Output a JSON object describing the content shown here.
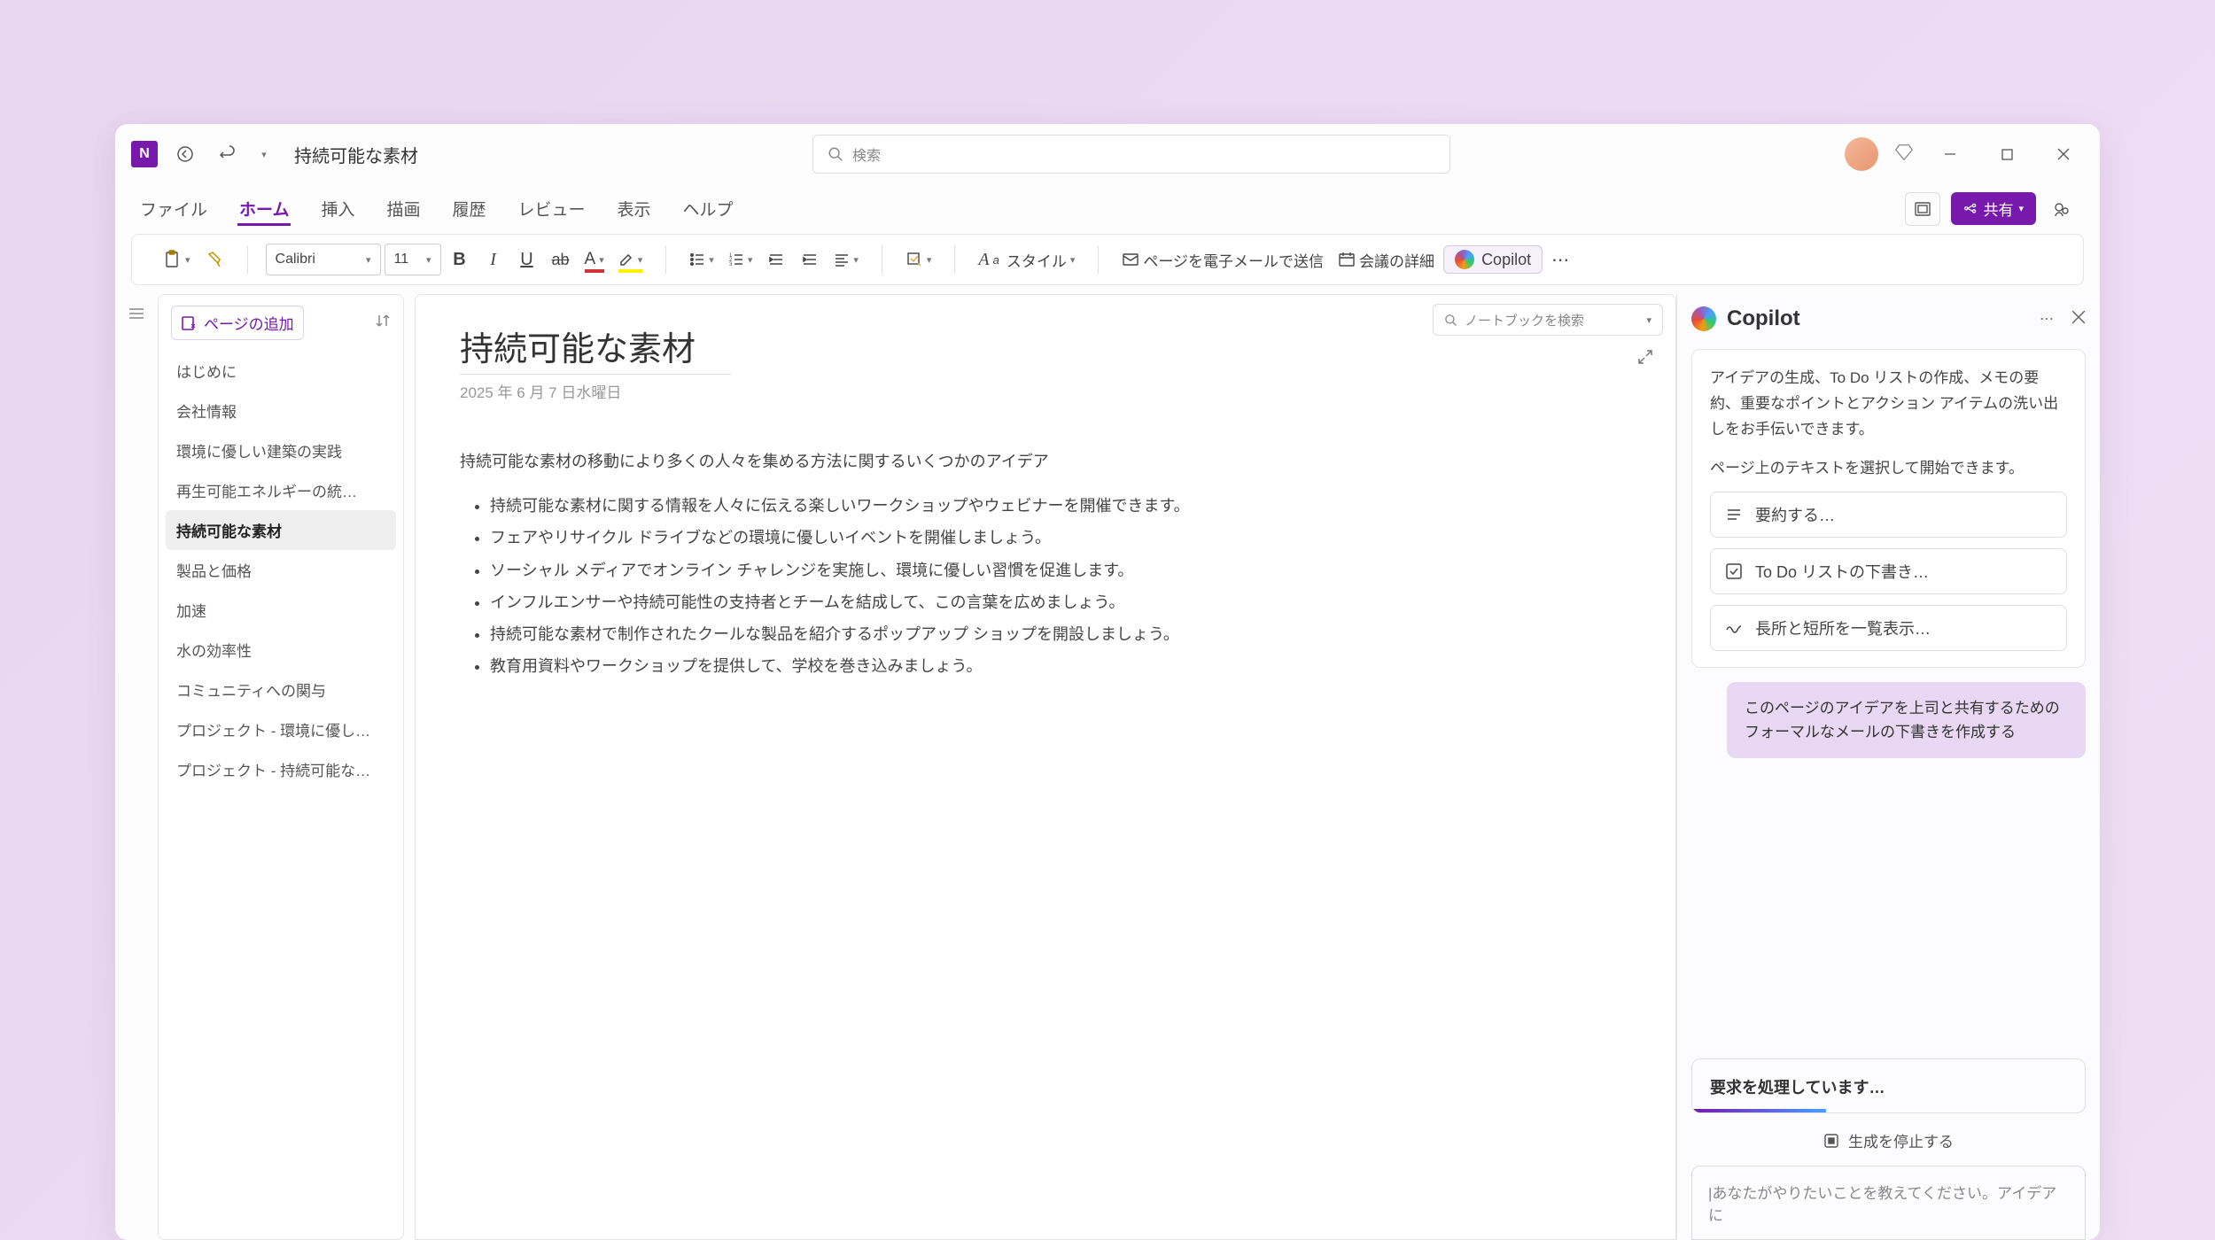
{
  "titlebar": {
    "doc_title": "持続可能な素材",
    "search_placeholder": "検索"
  },
  "tabs": {
    "items": [
      "ファイル",
      "ホーム",
      "挿入",
      "描画",
      "履歴",
      "レビュー",
      "表示",
      "ヘルプ"
    ],
    "active": 1,
    "share": "共有"
  },
  "ribbon": {
    "font_name": "Calibri",
    "font_size": "11",
    "style": "スタイル",
    "email": "ページを電子メールで送信",
    "meeting": "会議の詳細",
    "copilot": "Copilot"
  },
  "notebook_search": "ノートブックを検索",
  "nav": {
    "add_page": "ページの追加",
    "items": [
      "はじめに",
      "会社情報",
      "環境に優しい建築の実践",
      "再生可能エネルギーの統…",
      "持続可能な素材",
      "製品と価格",
      "加速",
      "水の効率性",
      "コミュニティへの関与",
      "プロジェクト - 環境に優し…",
      "プロジェクト - 持続可能な…"
    ],
    "active": 4
  },
  "page": {
    "title": "持続可能な素材",
    "date": "2025 年 6 月 7 日水曜日",
    "intro": "持続可能な素材の移動により多くの人々を集める方法に関するいくつかのアイデア",
    "bullets": [
      "持続可能な素材に関する情報を人々に伝える楽しいワークショップやウェビナーを開催できます。",
      "フェアやリサイクル ドライブなどの環境に優しいイベントを開催しましょう。",
      "ソーシャル メディアでオンライン チャレンジを実施し、環境に優しい習慣を促進します。",
      "インフルエンサーや持続可能性の支持者とチームを結成して、この言葉を広めましょう。",
      "持続可能な素材で制作されたクールな製品を紹介するポップアップ ショップを開設しましょう。",
      "教育用資料やワークショップを提供して、学校を巻き込みましょう。"
    ]
  },
  "copilot": {
    "title": "Copilot",
    "intro": "アイデアの生成、To Do リストの作成、メモの要約、重要なポイントとアクション アイテムの洗い出しをお手伝いできます。",
    "hint": "ページ上のテキストを選択して開始できます。",
    "suggestions": [
      "要約する…",
      "To Do リストの下書き…",
      "長所と短所を一覧表示…"
    ],
    "user_bubble": "このページのアイデアを上司と共有するためのフォーマルなメールの下書きを作成する",
    "processing": "要求を処理しています…",
    "stop": "生成を停止する",
    "input_placeholder": "|あなたがやりたいことを教えてください。アイデアに"
  }
}
